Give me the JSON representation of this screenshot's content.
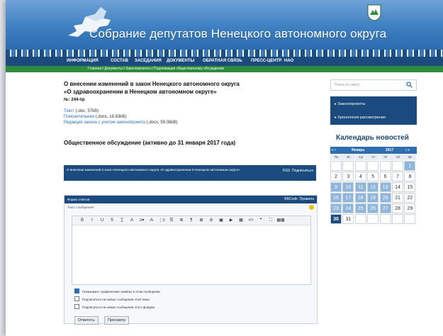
{
  "header": {
    "title": "Собрание депутатов Ненецкого автономного округа"
  },
  "nav": [
    "ИНФОРМАЦИЯ",
    "СОСТАВ",
    "ЗАСЕДАНИЯ",
    "ДОКУМЕНТЫ",
    "ОБРАТНАЯ СВЯЗЬ",
    "ПРЕСС-ЦЕНТР",
    "НАО"
  ],
  "breadcrumb": [
    "Главная",
    "Документы",
    "Законопроекты",
    "Подлежащие общественному обсуждению"
  ],
  "document": {
    "title": "О внесении изменений в закон Ненецкого автономного округа «О здравоохранении в Ненецком автономном округе»",
    "number": "№: 244-пр",
    "files": [
      {
        "link": "Текст",
        "meta": " (.doc, 57kB)"
      },
      {
        "link": "Пояснительная",
        "meta": " (.docx, 18.83kB)"
      },
      {
        "link": "Редакция закона с учетом законопроекта",
        "meta": " (.docx, 59.08kB)"
      }
    ],
    "discussion_heading": "Общественное обсуждение (активно до 31 января 2017 года)"
  },
  "topic": {
    "title": "О внесении изменений в закон Ненецкого автономного округа «О здравоохранении в Ненецком автономном округе»",
    "rss": "RSS",
    "subscribe": "Подписаться"
  },
  "reply_form": {
    "heading": "Форма ответов",
    "bbcode": "BBCode",
    "rules": "Правила",
    "message_label": "Текст сообщения*",
    "toolbar": [
      "B",
      "I",
      "U",
      "S",
      "T̲",
      "A",
      "≡▾",
      "·A·",
      "⋮≡",
      "☰",
      "≣",
      "¶",
      "⊞",
      "⊘",
      "▣",
      "▶",
      "▦",
      "<>",
      "❞",
      "⛶",
      "▦▦"
    ],
    "options": [
      {
        "label": "Показывать графические смайлы в этом сообщении",
        "checked": true
      },
      {
        "label": "Подписаться на новые сообщения этой темы",
        "checked": false
      },
      {
        "label": "Подписаться на новые сообщения этого форума",
        "checked": false
      }
    ],
    "reply_button": "Ответить",
    "preview_button": "Просмотр"
  },
  "sidebar": {
    "search_placeholder": "Поиск по сайту",
    "menu": [
      "Законопроекты",
      "Хронология рассмотрения"
    ],
    "calendar_title": "Календарь новостей",
    "calendar": {
      "prev": "« ‹",
      "month": "Январь",
      "year": "2017",
      "next": "› »",
      "weekdays": [
        "Пн",
        "Вт",
        "Ср",
        "Чт",
        "Пт",
        "Сб",
        "Вс"
      ],
      "rows": [
        [
          "",
          "",
          "",
          "",
          "",
          "",
          "1"
        ],
        [
          "2",
          "3",
          "4",
          "5",
          "6",
          "7",
          "8"
        ],
        [
          "9",
          "10",
          "11",
          "12",
          "13",
          "14",
          "15"
        ],
        [
          "16",
          "17",
          "18",
          "19",
          "20",
          "21",
          "22"
        ],
        [
          "23",
          "24",
          "25",
          "26",
          "27",
          "28",
          "29"
        ],
        [
          "30",
          "31",
          "",
          "",
          "",
          "",
          ""
        ]
      ],
      "today": "30"
    }
  }
}
